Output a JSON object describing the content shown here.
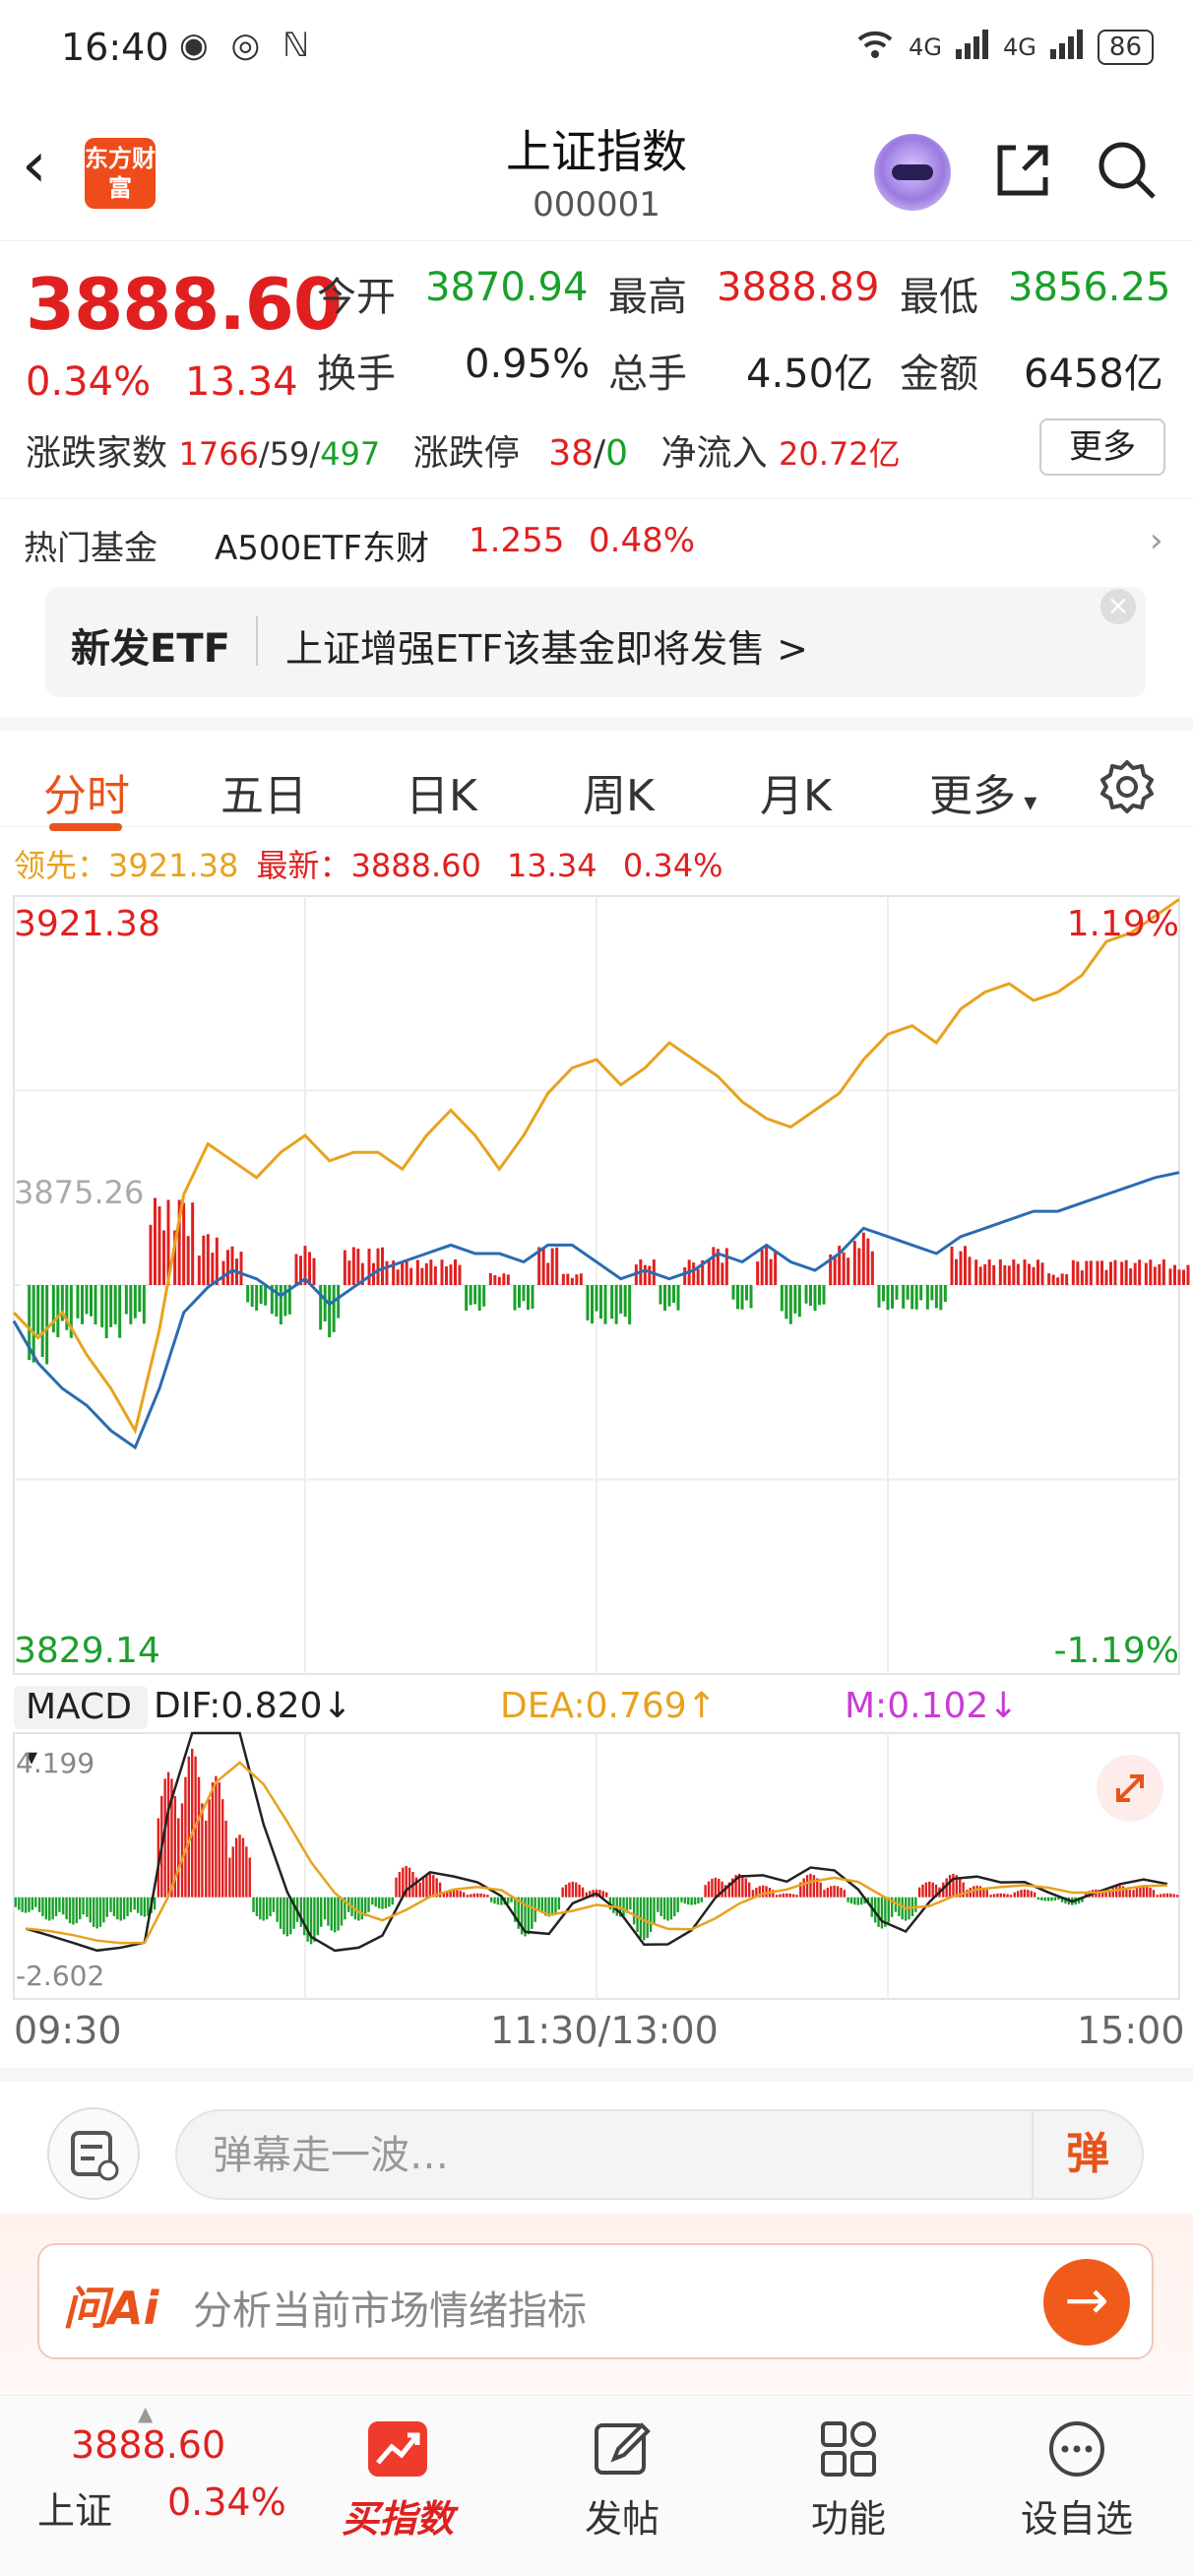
{
  "status_bar": {
    "time": "16:40",
    "battery": "86",
    "network": "4G"
  },
  "header": {
    "title": "上证指数",
    "code": "000001",
    "logo_text": "东方财富"
  },
  "quote": {
    "price": "3888.60",
    "change_pct": "0.34%",
    "change": "13.34",
    "open_label": "今开",
    "open": "3870.94",
    "high_label": "最高",
    "high": "3888.89",
    "low_label": "最低",
    "low": "3856.25",
    "turnover_label": "换手",
    "turnover": "0.95%",
    "volume_label": "总手",
    "volume": "4.50亿",
    "amount_label": "金额",
    "amount": "6458亿",
    "breadth_label": "涨跌家数",
    "up_count": "1766",
    "flat_count": "59",
    "down_count": "497",
    "limit_label": "涨跌停",
    "limit_up": "38",
    "limit_down": "0",
    "inflow_label": "净流入",
    "inflow": "20.72亿",
    "more_button": "更多"
  },
  "hot_fund": {
    "label": "热门基金",
    "name": "A500ETF东财",
    "price": "1.255",
    "pct": "0.48%"
  },
  "banner": {
    "tag": "新发ETF",
    "text": "上证增强ETF该基金即将发售  >"
  },
  "tabs": [
    {
      "label": "分时",
      "active": true
    },
    {
      "label": "五日"
    },
    {
      "label": "日K"
    },
    {
      "label": "周K"
    },
    {
      "label": "月K"
    },
    {
      "label": "更多"
    }
  ],
  "lead_line": {
    "lead_label": "领先：",
    "lead_value": "3921.38",
    "latest_label": "最新：",
    "latest_value": "3888.60",
    "change": "13.34",
    "pct": "0.34%"
  },
  "chart_data": [
    {
      "type": "line",
      "title": "",
      "y_top": "3921.38",
      "y_bottom": "3829.14",
      "pct_top": "1.19%",
      "pct_bottom": "-1.19%",
      "base_label": "3875.26",
      "ylim": [
        3829.14,
        3921.38
      ],
      "x_ticks": [
        "09:30",
        "11:30/13:00",
        "15:00"
      ],
      "series": [
        {
          "name": "领先",
          "color": "#e8a21e",
          "values": [
            3872,
            3869,
            3872,
            3867,
            3863,
            3858,
            3870,
            3886,
            3892,
            3890,
            3888,
            3891,
            3893,
            3890,
            3891,
            3891,
            3889,
            3893,
            3896,
            3893,
            3889,
            3893,
            3898,
            3901,
            3902,
            3899,
            3901,
            3904,
            3902,
            3900,
            3897,
            3895,
            3894,
            3896,
            3898,
            3902,
            3905,
            3906,
            3904,
            3908,
            3910,
            3911,
            3909,
            3910,
            3912,
            3916,
            3917,
            3919,
            3921
          ]
        },
        {
          "name": "最新",
          "color": "#2a6cb0",
          "values": [
            3871,
            3866,
            3863,
            3861,
            3858,
            3856,
            3863,
            3872,
            3875,
            3877,
            3876,
            3874,
            3876,
            3873,
            3875,
            3877,
            3878,
            3879,
            3880,
            3879,
            3879,
            3878,
            3880,
            3880,
            3878,
            3876,
            3877,
            3876,
            3877,
            3879,
            3878,
            3880,
            3878,
            3877,
            3879,
            3882,
            3881,
            3880,
            3879,
            3881,
            3882,
            3883,
            3884,
            3884,
            3885,
            3886,
            3887,
            3888,
            3888.6
          ]
        }
      ]
    },
    {
      "type": "bar",
      "title": "MACD",
      "dif": "0.820",
      "dea": "0.769",
      "m": "0.102",
      "ylim": [
        -2.602,
        4.199
      ],
      "top_label": "4.199",
      "bottom_label": "-2.602",
      "values": [
        -0.4,
        -0.6,
        -0.7,
        -0.8,
        -0.6,
        -0.5,
        3.2,
        3.8,
        3.1,
        1.6,
        -0.6,
        -1.0,
        -1.2,
        -0.9,
        -0.6,
        -0.3,
        0.8,
        0.6,
        0.2,
        0.1,
        -0.2,
        -1.0,
        -0.5,
        0.4,
        0.2,
        -0.5,
        -1.1,
        -0.6,
        -0.2,
        0.5,
        0.6,
        0.3,
        0.1,
        0.6,
        0.3,
        -0.2,
        -0.8,
        -0.6,
        0.4,
        0.6,
        0.3,
        0.1,
        0.2,
        -0.1,
        -0.2,
        0.2,
        0.3,
        0.3,
        0.1
      ]
    }
  ],
  "danmu": {
    "placeholder": "弹幕走一波…",
    "send": "弹"
  },
  "ai": {
    "logo": "问Ai",
    "prompt": "分析当前市场情绪指标",
    "go": "→"
  },
  "bottom_nav": {
    "index_price": "3888.60",
    "index_name": "上证",
    "index_pct": "0.34%",
    "items": [
      "买指数",
      "发帖",
      "功能",
      "设自选"
    ]
  },
  "colors": {
    "up": "#e02020",
    "down": "#1aa02a",
    "accent": "#e8531b",
    "lead": "#e8a21e",
    "latest": "#2a6cb0"
  }
}
